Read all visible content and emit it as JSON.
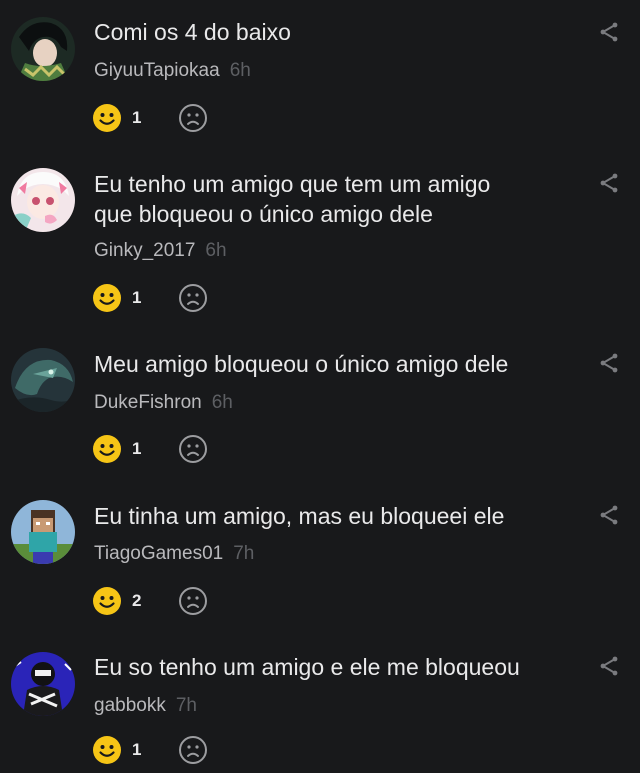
{
  "colors": {
    "background": "#18191b",
    "text": "#e9e9ea",
    "username": "#b9b9bc",
    "timestamp": "#5d5f63",
    "happy_reaction": "#f6c516",
    "sad_reaction_outline": "#9c9da0"
  },
  "icons": {
    "share": "share-icon",
    "happy": "happy-face-icon",
    "sad": "sad-face-icon"
  },
  "comments": [
    {
      "text": "Comi os 4 do baixo",
      "user": "GiyuuTapiokaa",
      "time": "6h",
      "happy_count": "1"
    },
    {
      "text": "Eu tenho um amigo que tem um amigo\nque bloqueou o único amigo dele",
      "user": "Ginky_2017",
      "time": "6h",
      "happy_count": "1"
    },
    {
      "text": "Meu amigo bloqueou o único amigo dele",
      "user": "DukeFishron",
      "time": "6h",
      "happy_count": "1"
    },
    {
      "text": "Eu tinha um amigo, mas eu bloqueei ele",
      "user": "TiagoGames01",
      "time": "7h",
      "happy_count": "2"
    },
    {
      "text": "Eu so tenho um amigo e ele me bloqueou",
      "user": "gabbokk",
      "time": "7h",
      "happy_count": "1"
    }
  ]
}
